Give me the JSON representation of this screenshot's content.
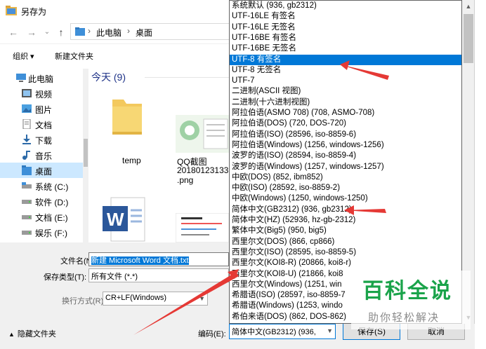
{
  "window": {
    "title": "另存为"
  },
  "nav": {
    "back_label": "←",
    "forward_label": "→",
    "recent_label": "⌄",
    "up_label": "↑"
  },
  "address": {
    "crumbs": [
      "此电脑",
      "桌面"
    ],
    "separator": "›"
  },
  "toolbar": {
    "organize_label": "组织 ▾",
    "new_folder_label": "新建文件夹"
  },
  "sidebar": {
    "items": [
      {
        "label": "此电脑",
        "icon": "computer-icon"
      },
      {
        "label": "视频",
        "icon": "video-folder-icon"
      },
      {
        "label": "图片",
        "icon": "pictures-folder-icon"
      },
      {
        "label": "文档",
        "icon": "documents-folder-icon"
      },
      {
        "label": "下载",
        "icon": "download-folder-icon"
      },
      {
        "label": "音乐",
        "icon": "music-folder-icon"
      },
      {
        "label": "桌面",
        "icon": "desktop-folder-icon"
      },
      {
        "label": "系统 (C:)",
        "icon": "drive-icon"
      },
      {
        "label": "软件 (D:)",
        "icon": "drive-icon"
      },
      {
        "label": "文档 (E:)",
        "icon": "drive-icon"
      },
      {
        "label": "娱乐 (F:)",
        "icon": "drive-icon"
      }
    ]
  },
  "content": {
    "group_header": "今天 (9)",
    "files": [
      {
        "name": "temp",
        "icon": "folder-icon"
      },
      {
        "name": "QQ截图 201801231331 .png",
        "name_line1": "QQ截图",
        "name_line2": "201801231331",
        "name_line3": ".png",
        "icon": "image-thumbnail-icon"
      },
      {
        "name": "",
        "icon": "word-document-icon"
      },
      {
        "name": "",
        "icon": "document-thumbnail-icon"
      }
    ]
  },
  "footer": {
    "filename_label": "文件名(N):",
    "filename_value": "新建 Microsoft Word 文档.txt",
    "savetype_label": "保存类型(T):",
    "savetype_value": "所有文件 (*.*)",
    "linebreak_label": "换行方式(R):",
    "linebreak_value": "CR+LF(Windows)",
    "encoding_label": "编码(E):",
    "encoding_value": "简体中文(GB2312) (936,",
    "hide_folders_label": "隐藏文件夹",
    "save_label": "保存(S)",
    "cancel_label": "取消"
  },
  "dropdown": {
    "selected_index": 4,
    "items": [
      "系统默认 (936, gb2312)",
      "UTF-16LE 有签名",
      "UTF-16LE 无签名",
      "UTF-16BE 有签名",
      "UTF-16BE 无签名",
      "UTF-8 有签名",
      "UTF-8 无签名",
      "UTF-7",
      "二进制(ASCII 视图)",
      "二进制(十六进制视图)",
      "阿拉伯语(ASMO 708) (708, ASMO-708)",
      "阿拉伯语(DOS) (720, DOS-720)",
      "阿拉伯语(ISO) (28596, iso-8859-6)",
      "阿拉伯语(Windows) (1256, windows-1256)",
      "波罗的语(ISO) (28594, iso-8859-4)",
      "波罗的语(Windows) (1257, windows-1257)",
      "中欧(DOS) (852, ibm852)",
      "中欧(ISO) (28592, iso-8859-2)",
      "中欧(Windows) (1250, windows-1250)",
      "简体中文(GB2312) (936, gb2312)",
      "简体中文(HZ) (52936, hz-gb-2312)",
      "繁体中文(Big5) (950, big5)",
      "西里尔文(DOS) (866, cp866)",
      "西里尔文(ISO) (28595, iso-8859-5)",
      "西里尔文(KOI8-R) (20866, koi8-r)",
      "西里尔文(KOI8-U) (21866, koi8",
      "西里尔文(Windows) (1251, win",
      "希腊语(ISO) (28597, iso-8859-7",
      "希腊语(Windows) (1253, windo",
      "希伯来语(DOS) (862, DOS-862)"
    ]
  },
  "watermark": {
    "main": "百科全说",
    "sub": "助你轻松解决"
  },
  "colors": {
    "selection": "#0078d7",
    "sidebar_active": "#cce8ff",
    "annotation_arrow": "#e53935",
    "watermark_green": "#1aa34a"
  }
}
